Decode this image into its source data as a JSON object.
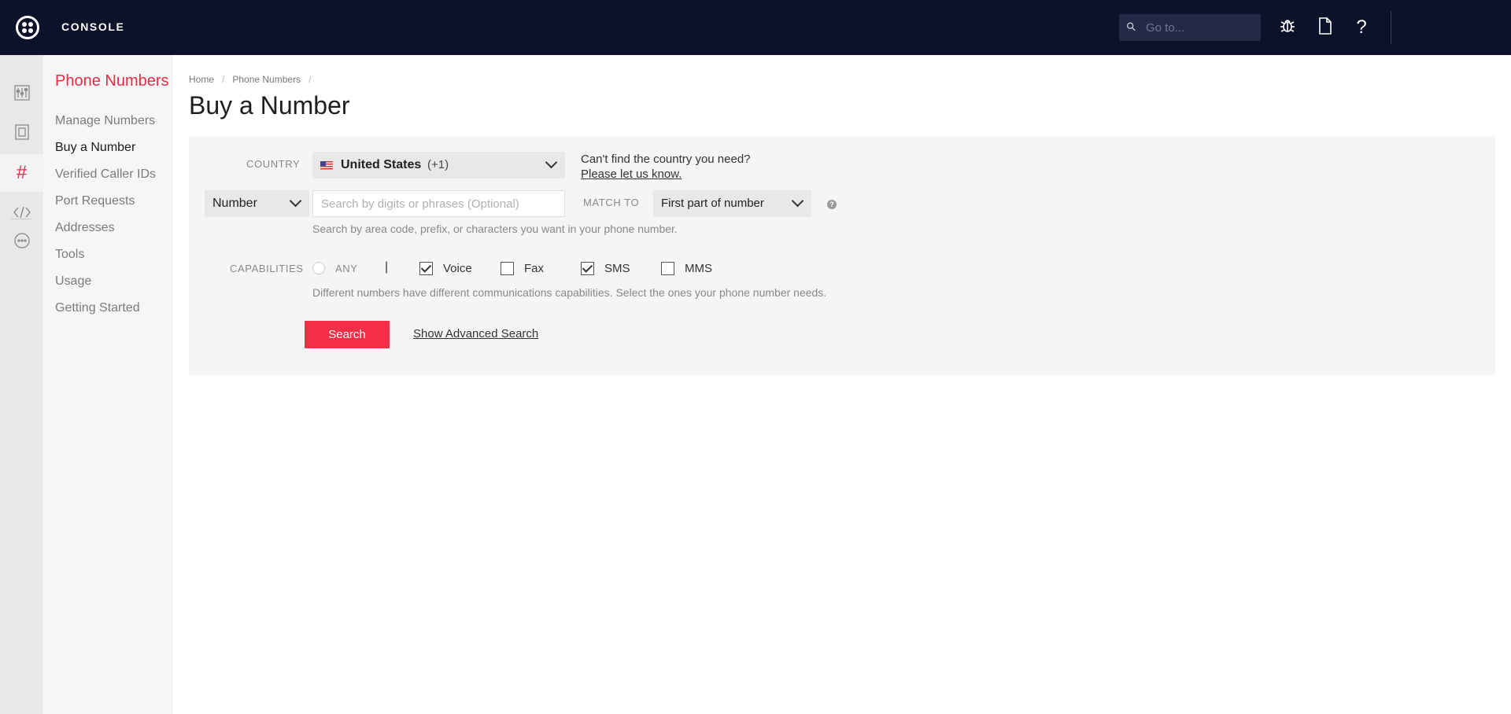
{
  "topbar": {
    "brand": "CONSOLE",
    "goto_placeholder": "Go to...",
    "icons": [
      "search-icon",
      "bug-icon",
      "document-icon",
      "help-icon"
    ]
  },
  "rail": {
    "icons": [
      "dashboard-icon",
      "runtime-icon",
      "phone-numbers-hash-icon",
      "developer-code-icon",
      "more-icon"
    ],
    "active": "phone-numbers-hash-icon"
  },
  "sidenav": {
    "title": "Phone Numbers",
    "items": [
      {
        "label": "Manage Numbers"
      },
      {
        "label": "Buy a Number"
      },
      {
        "label": "Verified Caller IDs"
      },
      {
        "label": "Port Requests"
      },
      {
        "label": "Addresses"
      },
      {
        "label": "Tools"
      },
      {
        "label": "Usage"
      },
      {
        "label": "Getting Started"
      }
    ],
    "active_index": 1
  },
  "breadcrumb": {
    "items": [
      "Home",
      "Phone Numbers"
    ],
    "separator": "/"
  },
  "page": {
    "title": "Buy a Number"
  },
  "form": {
    "country": {
      "label": "COUNTRY",
      "value": "United States",
      "code": "(+1)",
      "cant_find": "Can't find the country you need?",
      "let_us_know": "Please let us know."
    },
    "search": {
      "type_value": "Number",
      "placeholder": "Search by digits or phrases (Optional)",
      "match_label": "MATCH TO",
      "match_value": "First part of number",
      "help": "?",
      "hint": "Search by area code, prefix, or characters you want in your phone number."
    },
    "capabilities": {
      "label": "CAPABILITIES",
      "any": "ANY",
      "separator": "|",
      "options": [
        {
          "label": "Voice",
          "checked": true
        },
        {
          "label": "Fax",
          "checked": false
        },
        {
          "label": "SMS",
          "checked": true
        },
        {
          "label": "MMS",
          "checked": false
        }
      ],
      "hint": "Different numbers have different communications capabilities. Select the ones your phone number needs."
    },
    "search_button": "Search",
    "advanced_link": "Show Advanced Search"
  },
  "colors": {
    "topbar_bg": "#0d122b",
    "accent_red": "#f22f46",
    "panel_bg": "#f5f5f5"
  }
}
